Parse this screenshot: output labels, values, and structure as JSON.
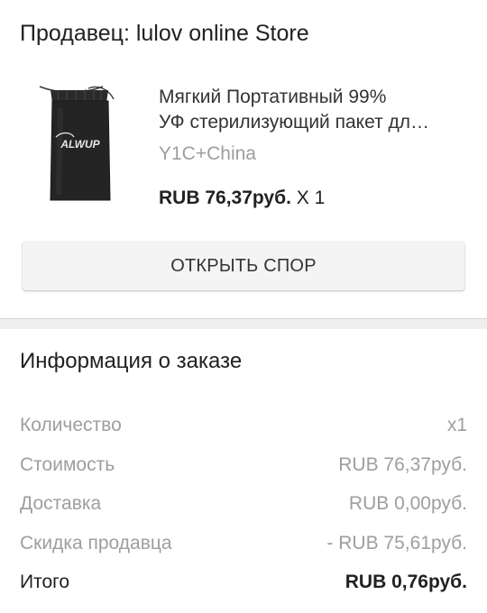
{
  "seller": {
    "label": "Продавец: lulov online Store"
  },
  "product": {
    "image_brand": "ALWUP",
    "title_line1": "Мягкий Портативный 99%",
    "title_line2": "УФ стерилизующий пакет дл…",
    "variant": "Y1C+China",
    "price": "RUB 76,37руб.",
    "quantity": "X 1"
  },
  "dispute_button": {
    "label": "ОТКРЫТЬ СПОР"
  },
  "order_info": {
    "title": "Информация о заказе",
    "rows": [
      {
        "label": "Количество",
        "value": "x1"
      },
      {
        "label": "Стоимость",
        "value": "RUB 76,37руб."
      },
      {
        "label": "Доставка",
        "value": "RUB 0,00руб."
      },
      {
        "label": "Скидка продавца",
        "value": "- RUB 75,61руб."
      }
    ],
    "total": {
      "label": "Итого",
      "value": "RUB 0,76руб."
    }
  },
  "colors": {
    "primary_text": "#212121",
    "secondary_text": "#9e9e9e",
    "button_bg": "#f4f4f4",
    "section_divider": "#efefef"
  }
}
